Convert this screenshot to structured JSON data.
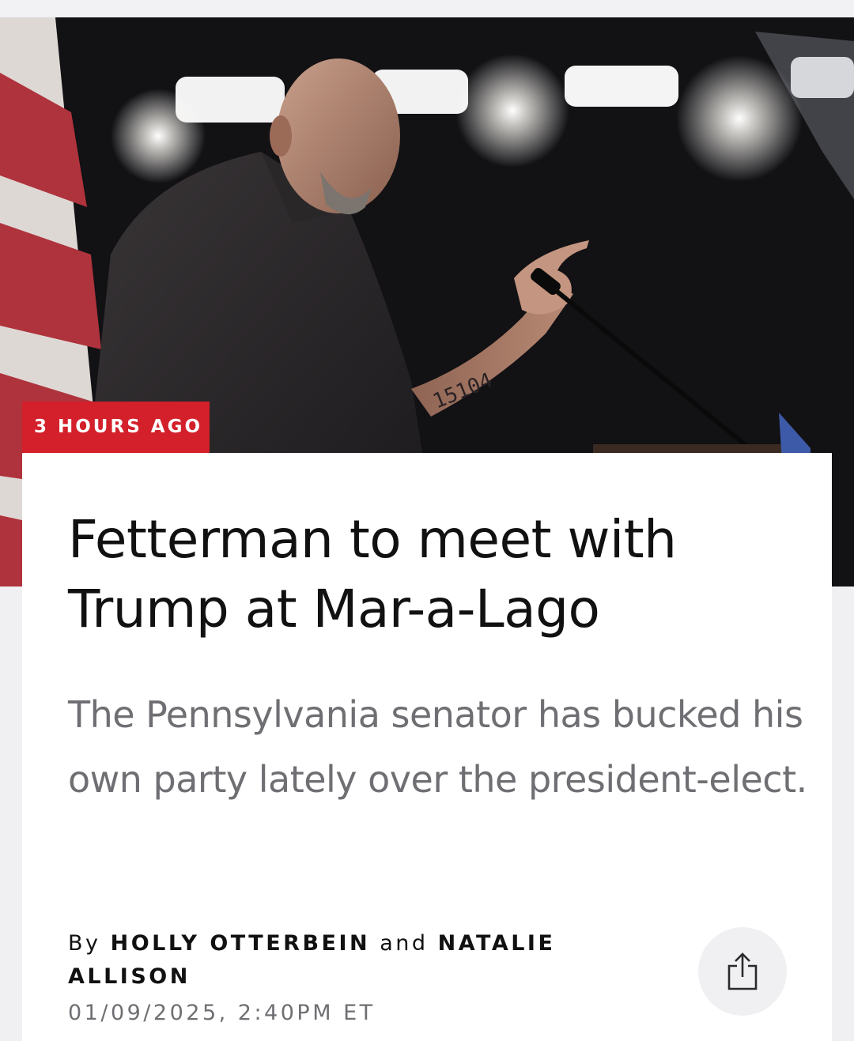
{
  "article": {
    "time_badge": "3 HOURS AGO",
    "headline": "Fetterman to meet with Trump at Mar-a-Lago",
    "subheadline": "The Pennsylvania senator has bucked his own party lately over the president-elect.",
    "byline": {
      "prefix": "By",
      "author_1": "HOLLY OTTERBEIN",
      "conjunction": "and",
      "author_2": "NATALIE ALLISON"
    },
    "timestamp": "01/09/2025, 2:40PM ET",
    "hero_image_tattoo_text": "15104"
  },
  "actions": {
    "share_icon": "share-icon"
  },
  "colors": {
    "badge_red": "#d3202b",
    "headline_text": "#111111",
    "subhead_text": "#6f6f73",
    "card_bg": "#ffffff",
    "page_bg": "#f0f0f2"
  }
}
